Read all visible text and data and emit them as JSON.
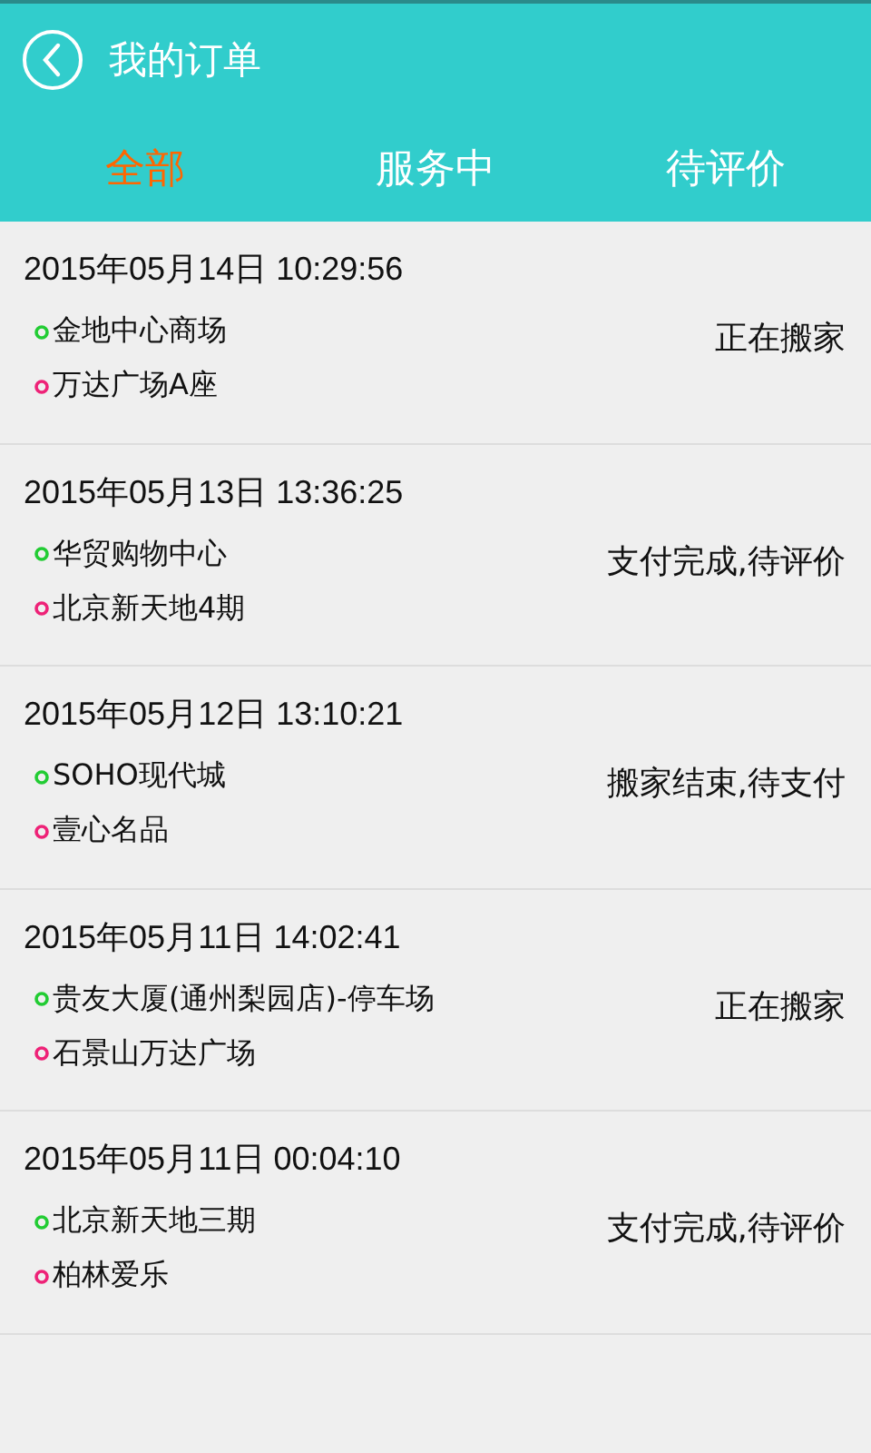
{
  "header": {
    "title": "我的订单"
  },
  "tabs": [
    {
      "label": "全部",
      "selected": true
    },
    {
      "label": "服务中",
      "selected": false
    },
    {
      "label": "待评价",
      "selected": false
    }
  ],
  "orders": [
    {
      "time": "2015年05月14日 10:29:56",
      "from": "金地中心商场",
      "to": "万达广场A座",
      "status": "正在搬家"
    },
    {
      "time": "2015年05月13日 13:36:25",
      "from": "华贸购物中心",
      "to": "北京新天地4期",
      "status": "支付完成,待评价"
    },
    {
      "time": "2015年05月12日 13:10:21",
      "from": "SOHO现代城",
      "to": "壹心名品",
      "status": "搬家结束,待支付"
    },
    {
      "time": "2015年05月11日 14:02:41",
      "from": "贵友大厦(通州梨园店)-停车场",
      "to": "石景山万达广场",
      "status": "正在搬家"
    },
    {
      "time": "2015年05月11日 00:04:10",
      "from": "北京新天地三期",
      "to": "柏林爱乐",
      "status": "支付完成,待评价"
    }
  ]
}
